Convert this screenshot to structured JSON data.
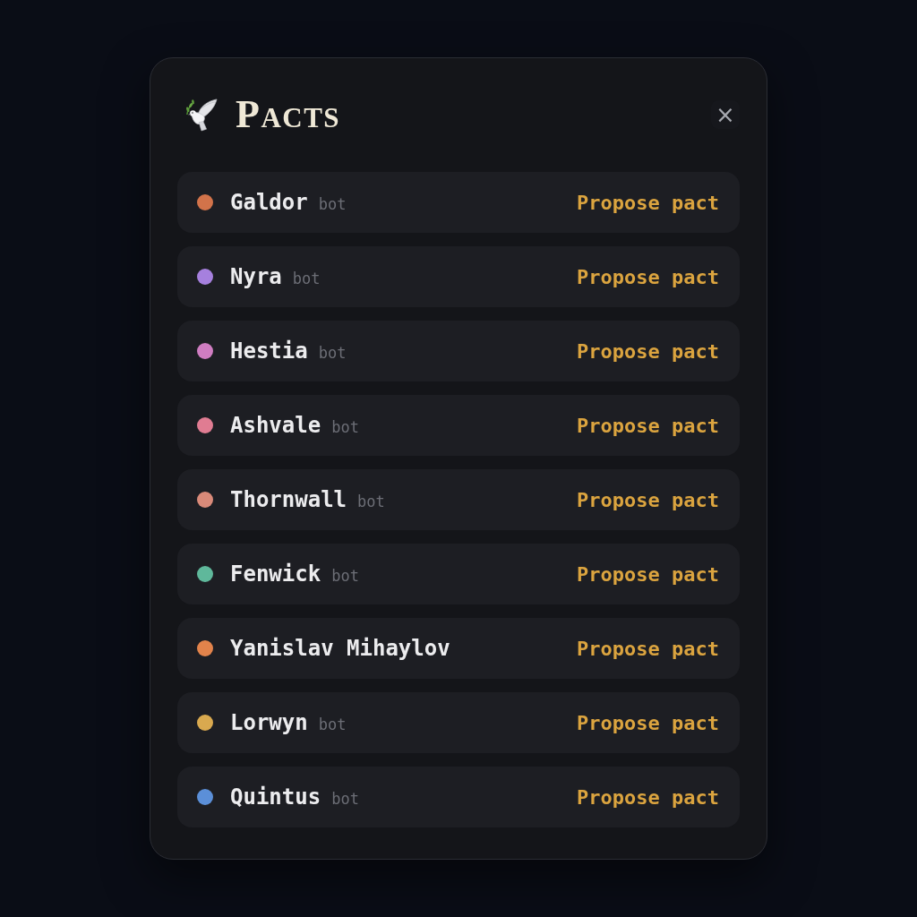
{
  "panel": {
    "title": "Pacts",
    "close": "×"
  },
  "players": [
    {
      "name": "Galdor",
      "tag": "bot",
      "color": "#d2734a",
      "action": "Propose pact"
    },
    {
      "name": "Nyra",
      "tag": "bot",
      "color": "#a680de",
      "action": "Propose pact"
    },
    {
      "name": "Hestia",
      "tag": "bot",
      "color": "#cf7dc1",
      "action": "Propose pact"
    },
    {
      "name": "Ashvale",
      "tag": "bot",
      "color": "#e07c92",
      "action": "Propose pact"
    },
    {
      "name": "Thornwall",
      "tag": "bot",
      "color": "#d98a79",
      "action": "Propose pact"
    },
    {
      "name": "Fenwick",
      "tag": "bot",
      "color": "#5fb89b",
      "action": "Propose pact"
    },
    {
      "name": "Yanislav Mihaylov",
      "color": "#e2834b",
      "action": "Propose pact"
    },
    {
      "name": "Lorwyn",
      "tag": "bot",
      "color": "#d9a94f",
      "action": "Propose pact"
    },
    {
      "name": "Quintus",
      "tag": "bot",
      "color": "#5b8fd8",
      "action": "Propose pact"
    }
  ]
}
